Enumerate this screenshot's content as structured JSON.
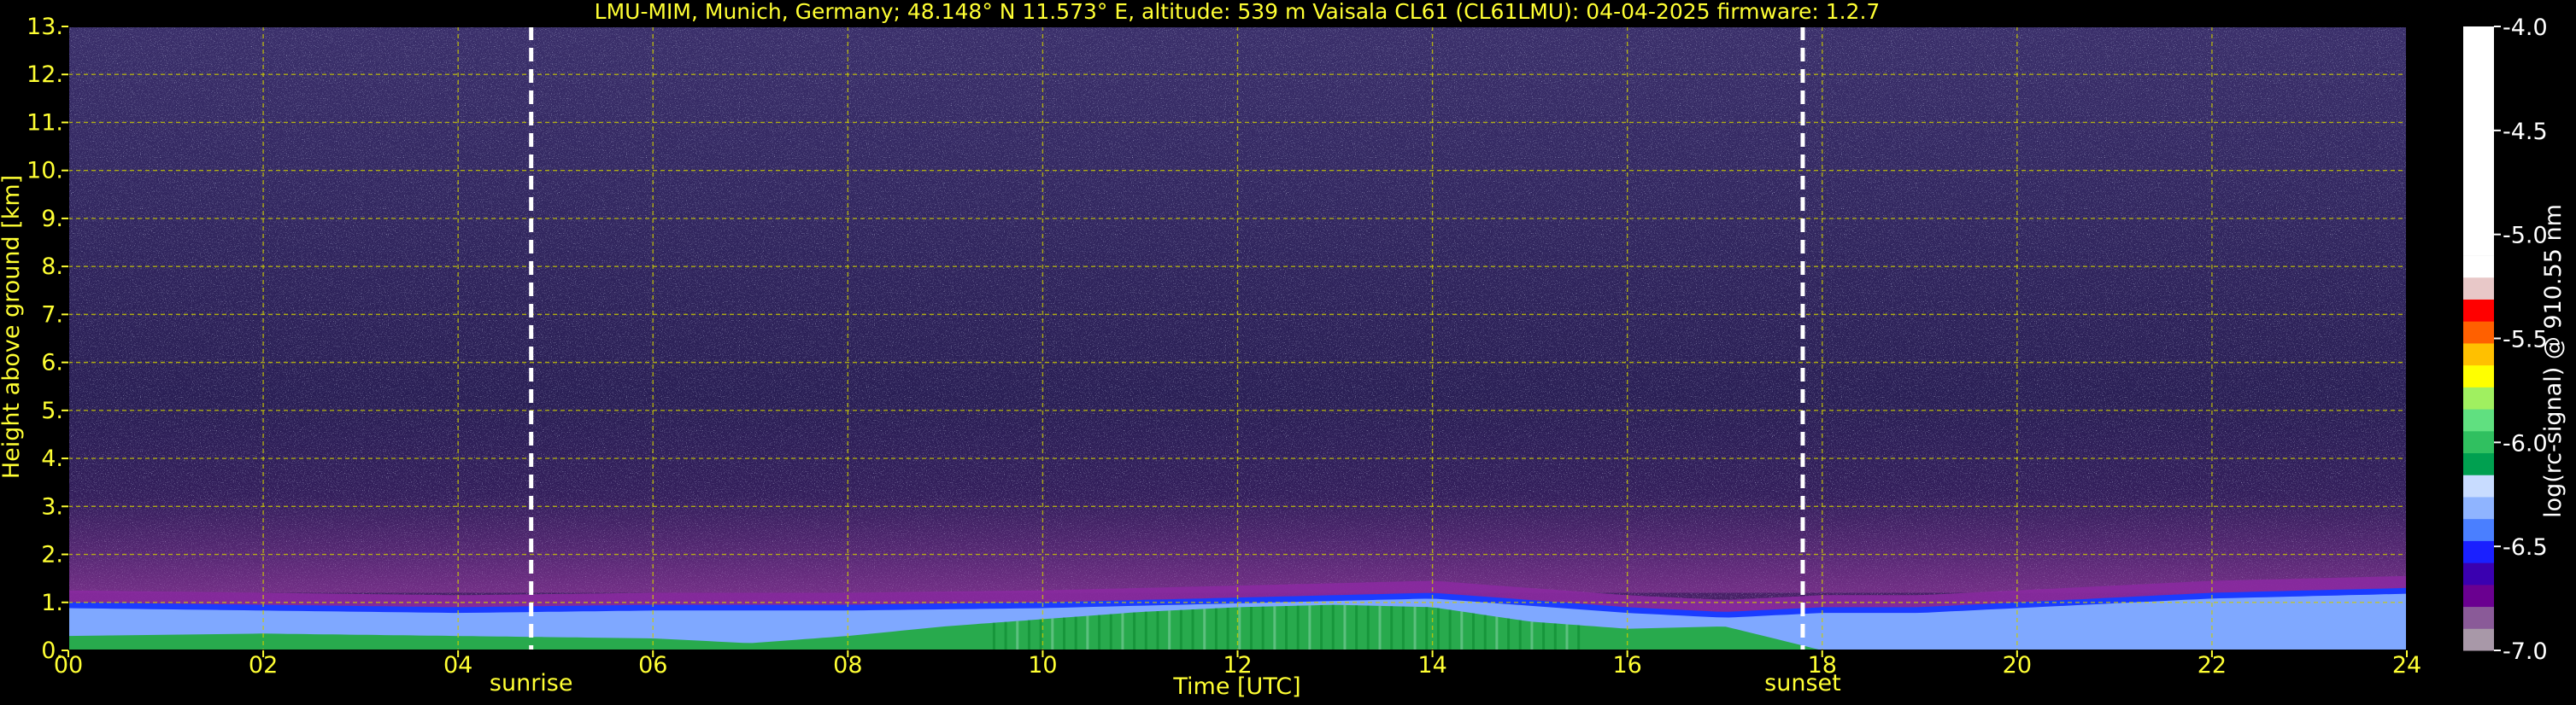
{
  "title": "LMU-MIM, Munich, Germany; 48.148° N 11.573° E, altitude: 539 m    Vaisala CL61 (CL61LMU): 04-04-2025    firmware: 1.2.7",
  "chart_data": {
    "type": "heatmap",
    "xlabel": "Time [UTC]",
    "ylabel": "Height above ground [km]",
    "colorbar_label": "log(rc-signal) @ 910.55 nm",
    "xlim": [
      0,
      24
    ],
    "ylim": [
      0,
      13
    ],
    "clim": [
      -7.0,
      -4.0
    ],
    "grid": true,
    "x_ticks": [
      0,
      2,
      4,
      6,
      8,
      10,
      12,
      14,
      16,
      18,
      20,
      22,
      24
    ],
    "x_tick_labels": [
      "00",
      "02",
      "04",
      "06",
      "08",
      "10",
      "12",
      "14",
      "16",
      "18",
      "20",
      "22",
      "24"
    ],
    "y_ticks": [
      0,
      1,
      2,
      3,
      4,
      5,
      6,
      7,
      8,
      9,
      10,
      11,
      12,
      13
    ],
    "y_tick_labels": [
      "0.",
      "1.",
      "2.",
      "3.",
      "4.",
      "5.",
      "6.",
      "7.",
      "8.",
      "9.",
      "10.",
      "11.",
      "12.",
      "13."
    ],
    "colorbar_ticks": [
      -4.0,
      -4.5,
      -5.0,
      -5.5,
      -6.0,
      -6.5,
      -7.0
    ],
    "colorbar_tick_labels": [
      "-4.0",
      "-4.5",
      "-5.0",
      "-5.5",
      "-6.0",
      "-6.5",
      "-7.0"
    ],
    "events": [
      {
        "label": "sunrise",
        "time": 4.75
      },
      {
        "label": "sunset",
        "time": 17.8
      }
    ],
    "boundary_layer_top_km": {
      "time": [
        0,
        2,
        4,
        6,
        8,
        10,
        11,
        12,
        13,
        14,
        15,
        16,
        17,
        18,
        19,
        20,
        21,
        22,
        23,
        24
      ],
      "height": [
        1.0,
        0.95,
        0.9,
        0.95,
        0.95,
        1.0,
        1.05,
        1.1,
        1.15,
        1.2,
        1.05,
        0.9,
        0.8,
        0.9,
        0.9,
        1.0,
        1.1,
        1.2,
        1.25,
        1.3
      ]
    },
    "green_layer_top_km": {
      "time": [
        0,
        2,
        4,
        6,
        7,
        8,
        9,
        10,
        11,
        12,
        13,
        14,
        15,
        16,
        17,
        18
      ],
      "height": [
        0.3,
        0.35,
        0.3,
        0.25,
        0.15,
        0.3,
        0.5,
        0.65,
        0.8,
        0.9,
        0.95,
        0.9,
        0.6,
        0.45,
        0.5,
        0.0
      ]
    },
    "colors": {
      "background": "#000000",
      "text": "#ffff33",
      "grid": "#cccc00",
      "noise_base": "#2a1f55",
      "boundary_layer": "#8a2aa0",
      "aerosol_blue": "#1a3cff",
      "aerosol_light": "#7fa8ff",
      "aerosol_green": "#1faa3a"
    },
    "colormap": [
      "#a898a8",
      "#8a5a98",
      "#6a0090",
      "#3a00b0",
      "#1a20ff",
      "#4a7fff",
      "#8fb4ff",
      "#c8dcff",
      "#00a050",
      "#30c060",
      "#60e080",
      "#a0f060",
      "#ffff00",
      "#ffc000",
      "#ff6000",
      "#ff0000",
      "#e8c8c8",
      "#ffffff"
    ]
  }
}
